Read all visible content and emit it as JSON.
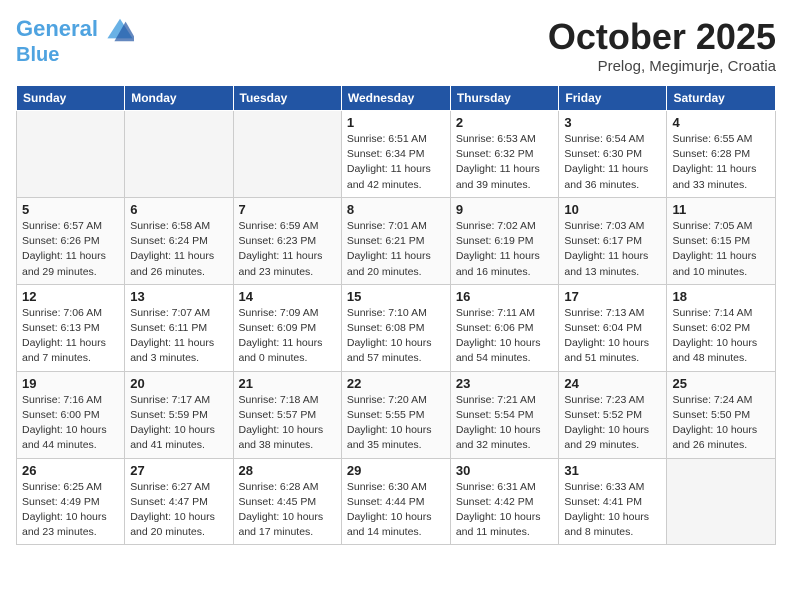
{
  "header": {
    "logo_line1": "General",
    "logo_line2": "Blue",
    "month": "October 2025",
    "location": "Prelog, Megimurje, Croatia"
  },
  "weekdays": [
    "Sunday",
    "Monday",
    "Tuesday",
    "Wednesday",
    "Thursday",
    "Friday",
    "Saturday"
  ],
  "weeks": [
    [
      {
        "day": "",
        "info": ""
      },
      {
        "day": "",
        "info": ""
      },
      {
        "day": "",
        "info": ""
      },
      {
        "day": "1",
        "info": "Sunrise: 6:51 AM\nSunset: 6:34 PM\nDaylight: 11 hours\nand 42 minutes."
      },
      {
        "day": "2",
        "info": "Sunrise: 6:53 AM\nSunset: 6:32 PM\nDaylight: 11 hours\nand 39 minutes."
      },
      {
        "day": "3",
        "info": "Sunrise: 6:54 AM\nSunset: 6:30 PM\nDaylight: 11 hours\nand 36 minutes."
      },
      {
        "day": "4",
        "info": "Sunrise: 6:55 AM\nSunset: 6:28 PM\nDaylight: 11 hours\nand 33 minutes."
      }
    ],
    [
      {
        "day": "5",
        "info": "Sunrise: 6:57 AM\nSunset: 6:26 PM\nDaylight: 11 hours\nand 29 minutes."
      },
      {
        "day": "6",
        "info": "Sunrise: 6:58 AM\nSunset: 6:24 PM\nDaylight: 11 hours\nand 26 minutes."
      },
      {
        "day": "7",
        "info": "Sunrise: 6:59 AM\nSunset: 6:23 PM\nDaylight: 11 hours\nand 23 minutes."
      },
      {
        "day": "8",
        "info": "Sunrise: 7:01 AM\nSunset: 6:21 PM\nDaylight: 11 hours\nand 20 minutes."
      },
      {
        "day": "9",
        "info": "Sunrise: 7:02 AM\nSunset: 6:19 PM\nDaylight: 11 hours\nand 16 minutes."
      },
      {
        "day": "10",
        "info": "Sunrise: 7:03 AM\nSunset: 6:17 PM\nDaylight: 11 hours\nand 13 minutes."
      },
      {
        "day": "11",
        "info": "Sunrise: 7:05 AM\nSunset: 6:15 PM\nDaylight: 11 hours\nand 10 minutes."
      }
    ],
    [
      {
        "day": "12",
        "info": "Sunrise: 7:06 AM\nSunset: 6:13 PM\nDaylight: 11 hours\nand 7 minutes."
      },
      {
        "day": "13",
        "info": "Sunrise: 7:07 AM\nSunset: 6:11 PM\nDaylight: 11 hours\nand 3 minutes."
      },
      {
        "day": "14",
        "info": "Sunrise: 7:09 AM\nSunset: 6:09 PM\nDaylight: 11 hours\nand 0 minutes."
      },
      {
        "day": "15",
        "info": "Sunrise: 7:10 AM\nSunset: 6:08 PM\nDaylight: 10 hours\nand 57 minutes."
      },
      {
        "day": "16",
        "info": "Sunrise: 7:11 AM\nSunset: 6:06 PM\nDaylight: 10 hours\nand 54 minutes."
      },
      {
        "day": "17",
        "info": "Sunrise: 7:13 AM\nSunset: 6:04 PM\nDaylight: 10 hours\nand 51 minutes."
      },
      {
        "day": "18",
        "info": "Sunrise: 7:14 AM\nSunset: 6:02 PM\nDaylight: 10 hours\nand 48 minutes."
      }
    ],
    [
      {
        "day": "19",
        "info": "Sunrise: 7:16 AM\nSunset: 6:00 PM\nDaylight: 10 hours\nand 44 minutes."
      },
      {
        "day": "20",
        "info": "Sunrise: 7:17 AM\nSunset: 5:59 PM\nDaylight: 10 hours\nand 41 minutes."
      },
      {
        "day": "21",
        "info": "Sunrise: 7:18 AM\nSunset: 5:57 PM\nDaylight: 10 hours\nand 38 minutes."
      },
      {
        "day": "22",
        "info": "Sunrise: 7:20 AM\nSunset: 5:55 PM\nDaylight: 10 hours\nand 35 minutes."
      },
      {
        "day": "23",
        "info": "Sunrise: 7:21 AM\nSunset: 5:54 PM\nDaylight: 10 hours\nand 32 minutes."
      },
      {
        "day": "24",
        "info": "Sunrise: 7:23 AM\nSunset: 5:52 PM\nDaylight: 10 hours\nand 29 minutes."
      },
      {
        "day": "25",
        "info": "Sunrise: 7:24 AM\nSunset: 5:50 PM\nDaylight: 10 hours\nand 26 minutes."
      }
    ],
    [
      {
        "day": "26",
        "info": "Sunrise: 6:25 AM\nSunset: 4:49 PM\nDaylight: 10 hours\nand 23 minutes."
      },
      {
        "day": "27",
        "info": "Sunrise: 6:27 AM\nSunset: 4:47 PM\nDaylight: 10 hours\nand 20 minutes."
      },
      {
        "day": "28",
        "info": "Sunrise: 6:28 AM\nSunset: 4:45 PM\nDaylight: 10 hours\nand 17 minutes."
      },
      {
        "day": "29",
        "info": "Sunrise: 6:30 AM\nSunset: 4:44 PM\nDaylight: 10 hours\nand 14 minutes."
      },
      {
        "day": "30",
        "info": "Sunrise: 6:31 AM\nSunset: 4:42 PM\nDaylight: 10 hours\nand 11 minutes."
      },
      {
        "day": "31",
        "info": "Sunrise: 6:33 AM\nSunset: 4:41 PM\nDaylight: 10 hours\nand 8 minutes."
      },
      {
        "day": "",
        "info": ""
      }
    ]
  ]
}
